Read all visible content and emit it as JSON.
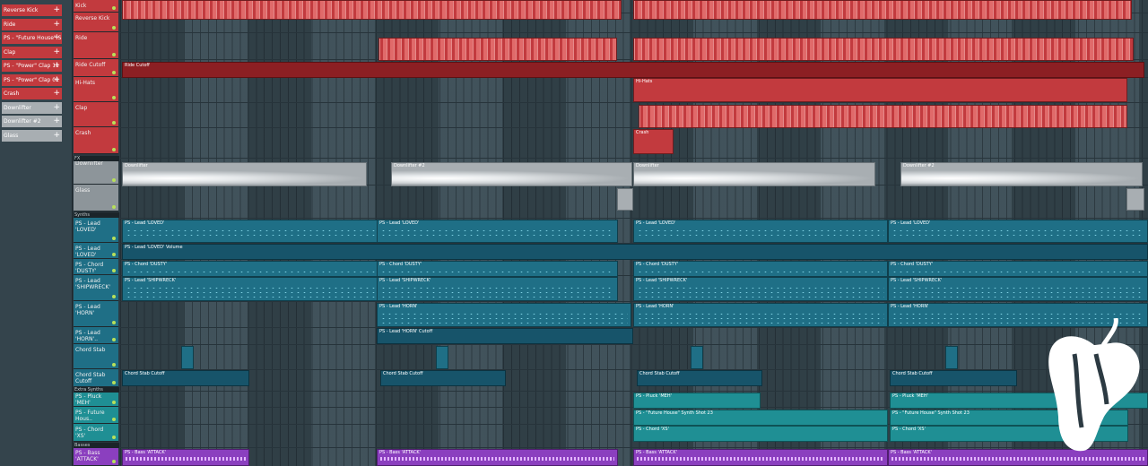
{
  "browser": {
    "items": [
      {
        "label": "Reverse Kick",
        "color": "#c23a3e"
      },
      {
        "label": "Ride",
        "color": "#c23a3e"
      },
      {
        "label": "PS - \"Future House\" S..",
        "color": "#c23a3e"
      },
      {
        "label": "Clap",
        "color": "#c23a3e"
      },
      {
        "label": "PS - \"Power\" Clap 11",
        "color": "#c23a3e"
      },
      {
        "label": "PS - \"Power\" Clap 01",
        "color": "#c23a3e"
      },
      {
        "label": "Crash",
        "color": "#c23a3e"
      },
      {
        "label": "Downlifter",
        "color": "#a8aeb2"
      },
      {
        "label": "Downlifter #2",
        "color": "#a8aeb2"
      },
      {
        "label": "Glass",
        "color": "#a8aeb2"
      }
    ]
  },
  "tracks": [
    {
      "label": "Kick",
      "color": "#c23a3e"
    },
    {
      "label": "Reverse Kick",
      "color": "#c23a3e"
    },
    {
      "label": "Ride",
      "color": "#c23a3e"
    },
    {
      "label": "Ride Cutoff",
      "color": "#c23a3e"
    },
    {
      "label": "Hi-Hats",
      "color": "#c23a3e"
    },
    {
      "label": "Clap",
      "color": "#c23a3e"
    },
    {
      "label": "Crash",
      "color": "#c23a3e"
    },
    {
      "label": "Downlifter",
      "color": "#8d959a"
    },
    {
      "label": "Glass",
      "color": "#8d959a"
    },
    {
      "label": "PS - Lead 'LOVED'",
      "color": "#1f6f86"
    },
    {
      "label": "PS - Lead 'LOVED'",
      "color": "#1f6f86"
    },
    {
      "label": "PS - Chord 'DUSTY'",
      "color": "#1f6f86"
    },
    {
      "label": "PS - Lead 'SHIPWRECK'",
      "color": "#1f6f86"
    },
    {
      "label": "PS - Lead 'HORN'",
      "color": "#1f6f86"
    },
    {
      "label": "PS - Lead 'HORN'..",
      "color": "#1f6f86"
    },
    {
      "label": "Chord Stab",
      "color": "#1f6f86"
    },
    {
      "label": "Chord Stab Cutoff",
      "color": "#1f6f86"
    },
    {
      "label": "PS - Pluck 'MEH'",
      "color": "#1f8f94"
    },
    {
      "label": "PS - Future Hous..",
      "color": "#1f8f94"
    },
    {
      "label": "PS - Chord 'XS'",
      "color": "#1f8f94"
    },
    {
      "label": "PS - Bass 'ATTACK'",
      "color": "#8b3fbf"
    }
  ],
  "sections": {
    "fx": "FX",
    "synths": "Synths",
    "extra_synths": "Extra Synths",
    "basses": "Basses"
  },
  "clips": {
    "ride_cutoff": "Ride Cutoff",
    "hihats": "Hi-Hats",
    "crash": "Crash",
    "downlifter": "Downlifter",
    "downlifter2": "Downlifter #2",
    "lead_loved": "PS - Lead 'LOVED'",
    "lead_loved_volume": "PS - Lead 'LOVED' Volume",
    "chord_dusty": "PS - Chord 'DUSTY'",
    "lead_shipwreck": "PS - Lead 'SHIPWRECK'",
    "lead_horn": "PS - Lead 'HORN'",
    "lead_horn_cutoff": "PS - Lead 'HORN' Cutoff",
    "chord_stab_cutoff": "Chord Stab Cutoff",
    "pluck_meh": "PS - Pluck 'MEH'",
    "future_house_synth": "PS - \"Future House\" Synth Shot 23",
    "chord_xs": "PS - Chord 'XS'",
    "bass_attack": "PS - Bass 'ATTACK'"
  },
  "logo": "fl-studio-fruit-icon"
}
